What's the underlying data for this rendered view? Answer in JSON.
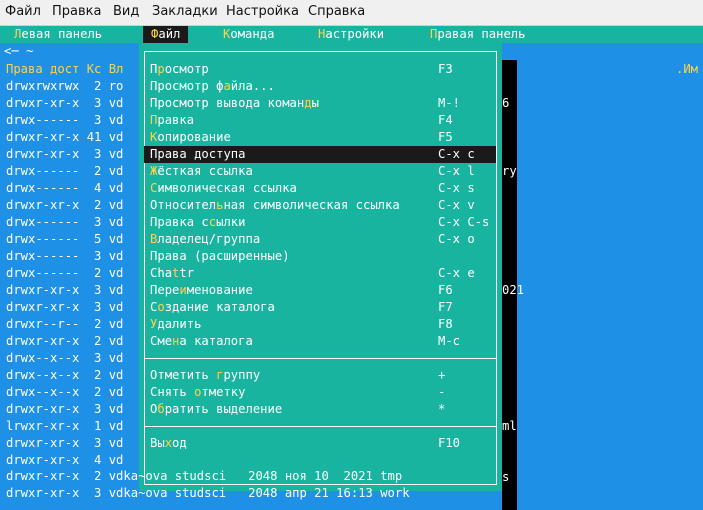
{
  "app_menu": [
    "Файл",
    "Правка",
    "Вид",
    "Закладки",
    "Настройка",
    "Справка"
  ],
  "mc_bar": {
    "left_panel": "Левая панель",
    "file": "Файл",
    "command": "Команда",
    "settings": "Настройки",
    "right_panel": "Правая панель"
  },
  "panel": {
    "path": "<─ ~",
    "header": "Права дост Кс Вл",
    "right_header": ".Им",
    "rows": [
      "drwxrwxrwx  2 ro",
      "drwxr-xr-x  3 vd",
      "drwx------  3 vd",
      "drwxr-xr-x 41 vd",
      "drwxr-xr-x  3 vd",
      "drwx------  2 vd",
      "drwx------  4 vd",
      "drwxr-xr-x  2 vd",
      "drwx------  3 vd",
      "drwx------  5 vd",
      "drwx------  3 vd",
      "drwx------  2 vd",
      "drwxr-xr-x  3 vd",
      "drwxr-xr-x  3 vd",
      "drwxr--r--  2 vd",
      "drwxr-xr-x  2 vd",
      "drwx--x--x  3 vd",
      "drwx--x--x  2 vd",
      "drwx--x--x  2 vd",
      "drwxr-xr-x  3 vd",
      "lrwxr-xr-x  1 vd",
      "drwxr-xr-x  3 vd",
      "drwxr-xr-x  4 vd"
    ],
    "right_fragments": [
      {
        "row": 2,
        "text": "6"
      },
      {
        "row": 6,
        "text": "ry"
      },
      {
        "row": 13,
        "text": "021"
      },
      {
        "row": 21,
        "text": "ml"
      },
      {
        "row": 24,
        "text": "s"
      }
    ],
    "tail_rows": [
      {
        "perm": "drwxr-xr-x  2",
        "rest": "vdka~ova studsci   2048 ноя 10  2021 tmp"
      },
      {
        "perm": "drwxr-xr-x  3",
        "rest": "vdka~ova studsci   2048 апр 21 16:13 work"
      }
    ]
  },
  "file_menu": {
    "items": [
      {
        "label": "Просмотр",
        "key": "F3"
      },
      {
        "label": "Просмотр файла...",
        "key": ""
      },
      {
        "label": "Просмотр вывода команды",
        "key": "M-!"
      },
      {
        "label": "Правка",
        "key": "F4"
      },
      {
        "label": "Копирование",
        "key": "F5"
      },
      {
        "label": "Права доступа",
        "key": "C-x c",
        "selected": true
      },
      {
        "label": "Жёсткая ссылка",
        "key": "C-x l"
      },
      {
        "label": "Символическая ссылка",
        "key": "C-x s"
      },
      {
        "label": "Относительная символическая ссылка",
        "key": "C-x v"
      },
      {
        "label": "Правка ссылки",
        "key": "C-x C-s"
      },
      {
        "label": "Владелец/группа",
        "key": "C-x o"
      },
      {
        "label": "Права (расширенные)",
        "key": ""
      },
      {
        "label": "Chattr",
        "key": "C-x e"
      },
      {
        "label": "Переименование",
        "key": "F6"
      },
      {
        "label": "Создание каталога",
        "key": "F7"
      },
      {
        "label": "Удалить",
        "key": "F8"
      },
      {
        "label": "Смена каталога",
        "key": "M-c"
      }
    ],
    "group_items": [
      {
        "label": "Отметить группу",
        "key": "+"
      },
      {
        "label": "Снять отметку",
        "key": "-"
      },
      {
        "label": "Обратить выделение",
        "key": "*"
      }
    ],
    "exit_item": {
      "label": "Выход",
      "key": "F10"
    }
  }
}
